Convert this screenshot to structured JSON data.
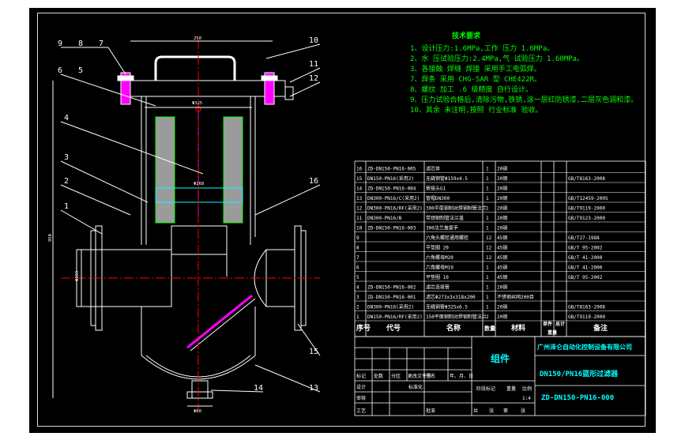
{
  "balloons": [
    "9",
    "8",
    "7",
    "6",
    "5",
    "4",
    "3",
    "2",
    "1",
    "10",
    "11",
    "12",
    "16",
    "15",
    "14",
    "13"
  ],
  "dimensions": {
    "d250": "250",
    "d325": "Φ325",
    "d268": "Φ268",
    "d159": "Φ159",
    "d950": "950",
    "d60": "Φ60"
  },
  "tech_requirements": {
    "title": "技术要求",
    "items": [
      "1、设计压力:1.6MPa,工作 压力 1.6MPa。",
      "2、水 压试验压力:2.4MPa,气 试验压力 1.60MPa。",
      "3、各接触 焊缝 焊接 采用手工电弧焊。",
      "7、焊条 采用 CHG-SAR 型 CHE422R。",
      "8、螺纹 加工 .6 级精度 自行设计。",
      "9、压力试验合格后,清除污物,铁锈,涂一层红防锈漆,二层灰色调和漆。",
      "10、其余 未注明,按照 行业标准 验收。"
    ]
  },
  "bom": {
    "headers": [
      "序号",
      "代号",
      "名称",
      "数量",
      "材料",
      "单件",
      "总计",
      "备注"
    ],
    "weight_label": "重量",
    "rows": [
      [
        "16",
        "ZD-DN150-PN16-005",
        "滤芯体",
        "1",
        "20钢",
        ""
      ],
      [
        "15",
        "DN150-PN16(采用2)",
        "无缝钢管Φ159x4.5",
        "1",
        "20钢",
        "GB/T8163-2008"
      ],
      [
        "14",
        "ZD-DN150-PN16-004",
        "管接头G1",
        "1",
        "20钢",
        ""
      ],
      [
        "13",
        "DN300-PN16/C(采用2)",
        "管帽DN300",
        "1",
        "20钢",
        "GB/T12459-2005"
      ],
      [
        "12",
        "DN300-PN16/RF(采用2)",
        "300平面钢制对焊钢制管法兰",
        "1",
        "20钢",
        "GB/T9119-2000"
      ],
      [
        "11",
        "DN300-PN16/B",
        "带颈钢制管法兰盖",
        "1",
        "20钢",
        "GB/T9123-2000"
      ],
      [
        "10",
        "ZD-DN150-PN16-003",
        "300法兰盖提手",
        "1",
        "20钢",
        ""
      ],
      [
        "9",
        "",
        "六角头螺栓通用螺栓",
        "12",
        "45钢",
        "GB/T27-1988"
      ],
      [
        "8",
        "",
        "平垫圈 20",
        "12",
        "45钢",
        "GB/T 95-2002"
      ],
      [
        "7",
        "",
        "六角螺母M20",
        "12",
        "45钢",
        "GB/T 41-2000"
      ],
      [
        "6",
        "",
        "六角螺母M10",
        "1",
        "45钢",
        "GB/T 41-2000"
      ],
      [
        "5",
        "",
        "平垫圈 10",
        "1",
        "45钢",
        "GB/T 95-2002"
      ],
      [
        "4",
        "ZD-DN150-PN16-002",
        "滤芯连接管",
        "1",
        "20钢",
        ""
      ],
      [
        "3",
        "ZD-DN150-PN16-001",
        "滤芯Φ273x3x318x200",
        "1",
        "不锈钢丝网200目",
        ""
      ],
      [
        "2",
        "DN300-PN16(采用2)",
        "无缝钢管Φ325x6.5",
        "1",
        "20钢",
        "GB/T8163-2008"
      ],
      [
        "1",
        "DN150-PN16/RF(采用2)",
        "150平面钢制对焊钢制管法兰",
        "2",
        "20钢",
        "GB/T9119-2000"
      ]
    ]
  },
  "title_block": {
    "assembly": "组件",
    "company": "广州泽仑自动化控制设备有限公司",
    "drawing_name": "DN150/PN16篮形过滤器",
    "drawing_no": "ZD-DN150-PN16-000",
    "labels": [
      "标记",
      "处数",
      "分区",
      "更改文件号",
      "签名",
      "年、月、日"
    ],
    "design": "设计",
    "standardize": "标准化",
    "stage_mark": "阶段标记",
    "weight": "重量",
    "scale": "比例",
    "scale_value": "1:4",
    "review": "审核",
    "process": "工艺",
    "approve": "批准",
    "sheets": [
      "共",
      "张",
      "第",
      "张"
    ]
  }
}
